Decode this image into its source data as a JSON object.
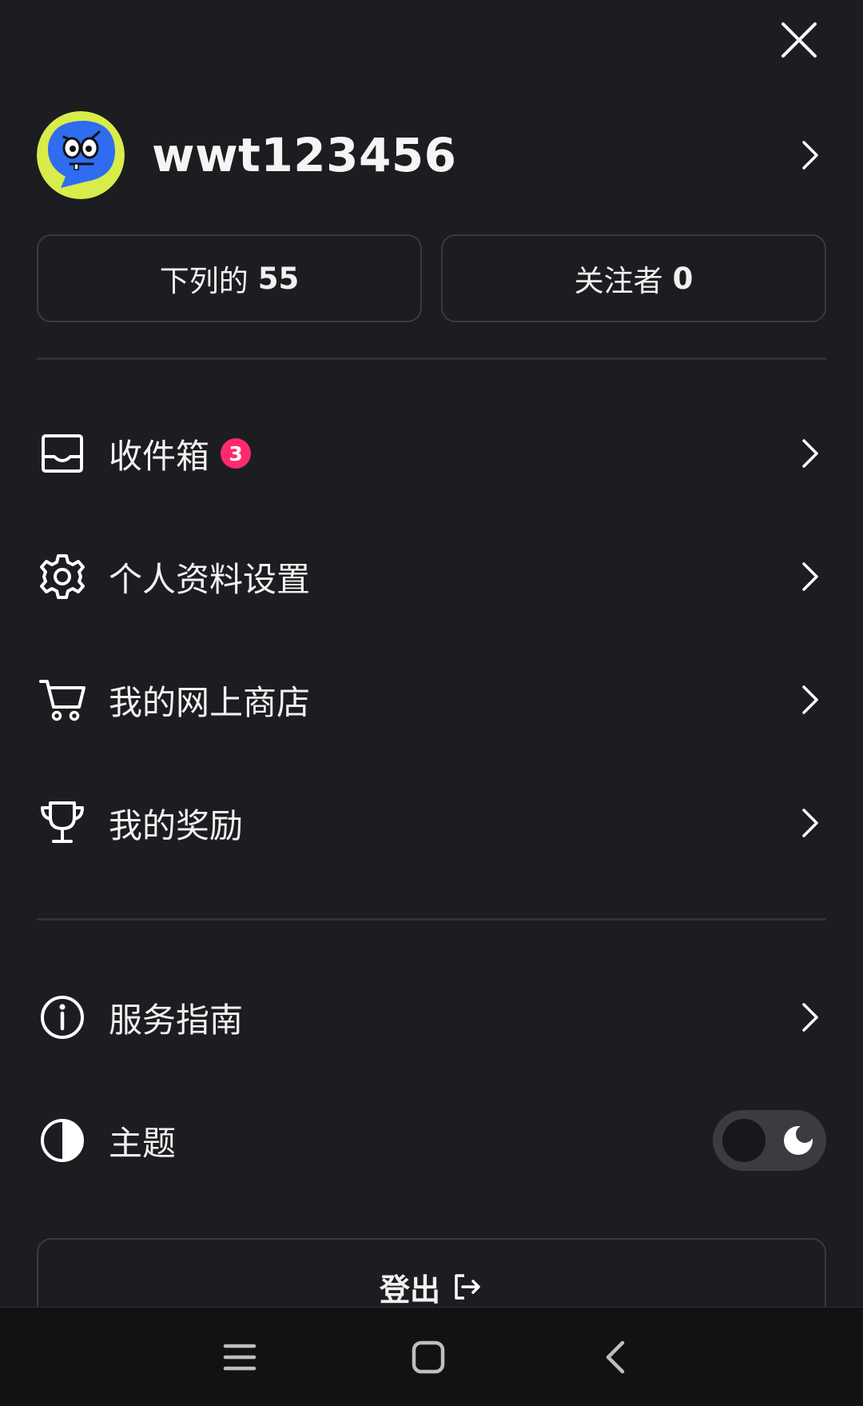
{
  "close": {
    "icon": "close-icon"
  },
  "profile": {
    "username": "wwt123456",
    "avatar_icon": "cartoon-face-avatar"
  },
  "stats": {
    "following_label": "下列的",
    "following_count": "55",
    "followers_label": "关注者",
    "followers_count": "0"
  },
  "menu": [
    {
      "label": "收件箱",
      "icon": "inbox-icon",
      "badge": "3"
    },
    {
      "label": "个人资料设置",
      "icon": "gear-icon"
    },
    {
      "label": "我的网上商店",
      "icon": "cart-icon"
    },
    {
      "label": "我的奖励",
      "icon": "trophy-icon"
    }
  ],
  "menu2": [
    {
      "label": "服务指南",
      "icon": "info-icon"
    },
    {
      "label": "主题",
      "icon": "contrast-icon"
    }
  ],
  "theme": {
    "mode": "dark"
  },
  "logout": {
    "label": "登出"
  },
  "nav": {
    "items": [
      "menu-icon",
      "home-icon",
      "back-icon"
    ]
  },
  "colors": {
    "background": "#1c1d20",
    "badge": "#ff2a6d",
    "avatar_bg": "#2f6cf0",
    "avatar_ring": "#d8ec4a"
  }
}
